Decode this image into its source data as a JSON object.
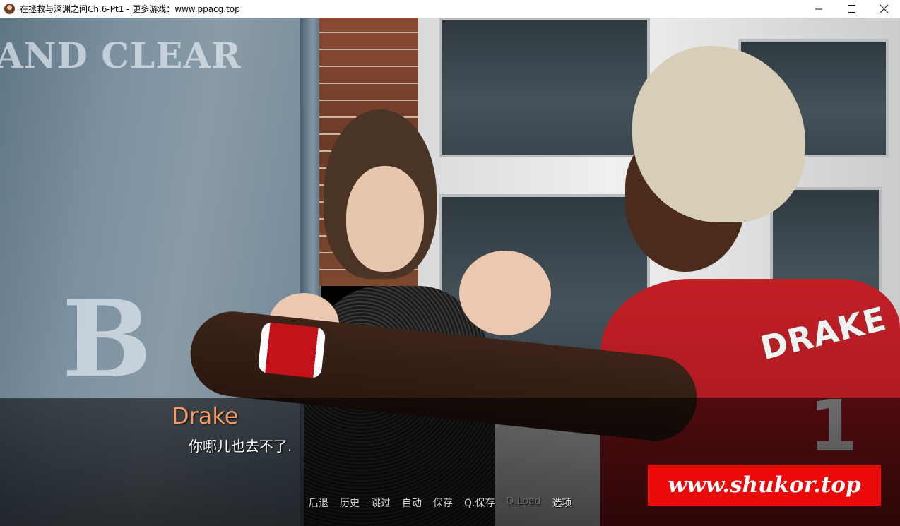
{
  "window": {
    "title": "在拯救与深渊之间Ch.6-Pt1 - 更多游戏：www.ppacg.top",
    "icon": "app-icon",
    "controls": {
      "minimize": "minimize-icon",
      "maximize": "maximize-icon",
      "close": "close-icon"
    }
  },
  "scene": {
    "stencil_top": "AND CLEAR",
    "stencil_letter": "B",
    "jersey_name": "DRAKE",
    "jersey_number": "1"
  },
  "dialogue": {
    "speaker": "Drake",
    "speaker_color": "#f29a68",
    "text": "你哪儿也去不了."
  },
  "quick_menu": {
    "items": [
      {
        "label": "后退",
        "enabled": true
      },
      {
        "label": "历史",
        "enabled": true
      },
      {
        "label": "跳过",
        "enabled": true
      },
      {
        "label": "自动",
        "enabled": true
      },
      {
        "label": "保存",
        "enabled": true
      },
      {
        "label": "Q.保存",
        "enabled": true
      },
      {
        "label": "Q.Load",
        "enabled": false
      },
      {
        "label": "选项",
        "enabled": true
      }
    ]
  },
  "watermark": {
    "text": "www.shukor.top",
    "color": "#ea0a0a"
  }
}
